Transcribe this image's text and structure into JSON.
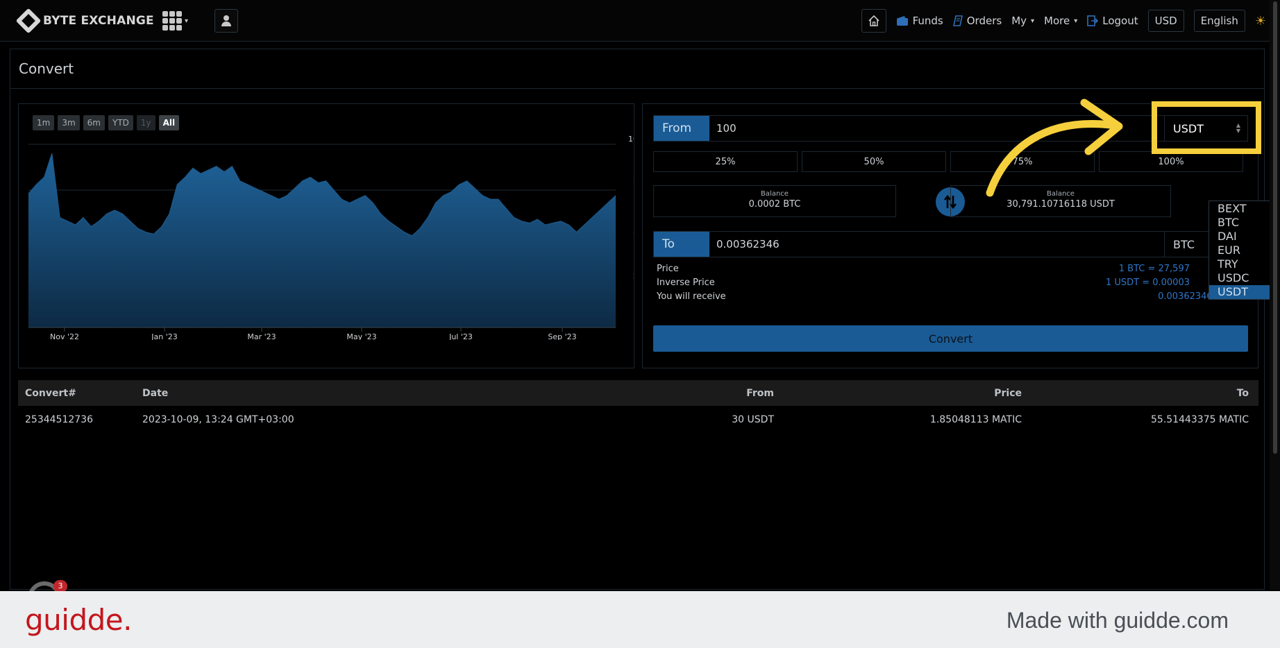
{
  "nav": {
    "logo_text": "BYTE EXCHANGE",
    "links": {
      "funds": "Funds",
      "orders": "Orders",
      "my": "My",
      "more": "More",
      "logout": "Logout"
    },
    "currency": "USD",
    "language": "English"
  },
  "page": {
    "title": "Convert"
  },
  "chart": {
    "range_buttons": [
      "1m",
      "3m",
      "6m",
      "YTD",
      "1y",
      "All"
    ],
    "active_range": "All",
    "disabled_range": "1y"
  },
  "chart_data": {
    "type": "area",
    "x": [
      "Nov '22",
      "Jan '23",
      "Mar '23",
      "May '23",
      "Jul '23",
      "Sep '23"
    ],
    "ylim": [
      0,
      100
    ],
    "y_ticks": [
      "0",
      "25",
      "50",
      "75",
      "100"
    ],
    "values": [
      73,
      78,
      82,
      95,
      60,
      58,
      56,
      60,
      55,
      58,
      62,
      64,
      62,
      58,
      54,
      52,
      51,
      55,
      62,
      78,
      82,
      87,
      84,
      86,
      88,
      85,
      88,
      80,
      78,
      76,
      74,
      72,
      70,
      72,
      76,
      80,
      82,
      79,
      80,
      75,
      70,
      68,
      70,
      72,
      68,
      62,
      58,
      55,
      52,
      50,
      54,
      60,
      68,
      72,
      74,
      78,
      80,
      76,
      72,
      70,
      70,
      65,
      60,
      58,
      57,
      59,
      56,
      57,
      58,
      56,
      52,
      56,
      60,
      64,
      68,
      72
    ],
    "color": "#1d5a8c"
  },
  "convert": {
    "from_label": "From",
    "from_value": "100",
    "from_currency": "USDT",
    "pct_buttons": [
      "25%",
      "50%",
      "75%",
      "100%"
    ],
    "balance_left_label": "Balance",
    "balance_left_value": "0.0002 BTC",
    "balance_right_label": "Balance",
    "balance_right_value": "30,791.10716118 USDT",
    "to_label": "To",
    "to_value": "0.00362346",
    "to_currency": "BTC",
    "price_label": "Price",
    "price_value": "1 BTC = 27,597",
    "inverse_label": "Inverse Price",
    "inverse_value": "1 USDT = 0.00003",
    "receive_label": "You will receive",
    "receive_value": "0.00362346 BTC",
    "button": "Convert"
  },
  "dropdown": {
    "options": [
      "BEXT",
      "BTC",
      "DAI",
      "EUR",
      "TRY",
      "USDC",
      "USDT"
    ],
    "selected": "USDT"
  },
  "history": {
    "headers": [
      "Convert#",
      "Date",
      "From",
      "Price",
      "To"
    ],
    "rows": [
      [
        "25344512736",
        "2023-10-09, 13:24 GMT+03:00",
        "30 USDT",
        "1.85048113 MATIC",
        "55.51443375 MATIC"
      ]
    ]
  },
  "notification_count": "3",
  "footer": {
    "logo": "guidde.",
    "tagline": "Made with guidde.com"
  },
  "colors": {
    "accent": "#1a5b95",
    "highlight": "#f6cf3c",
    "brand_red": "#c4161c"
  }
}
